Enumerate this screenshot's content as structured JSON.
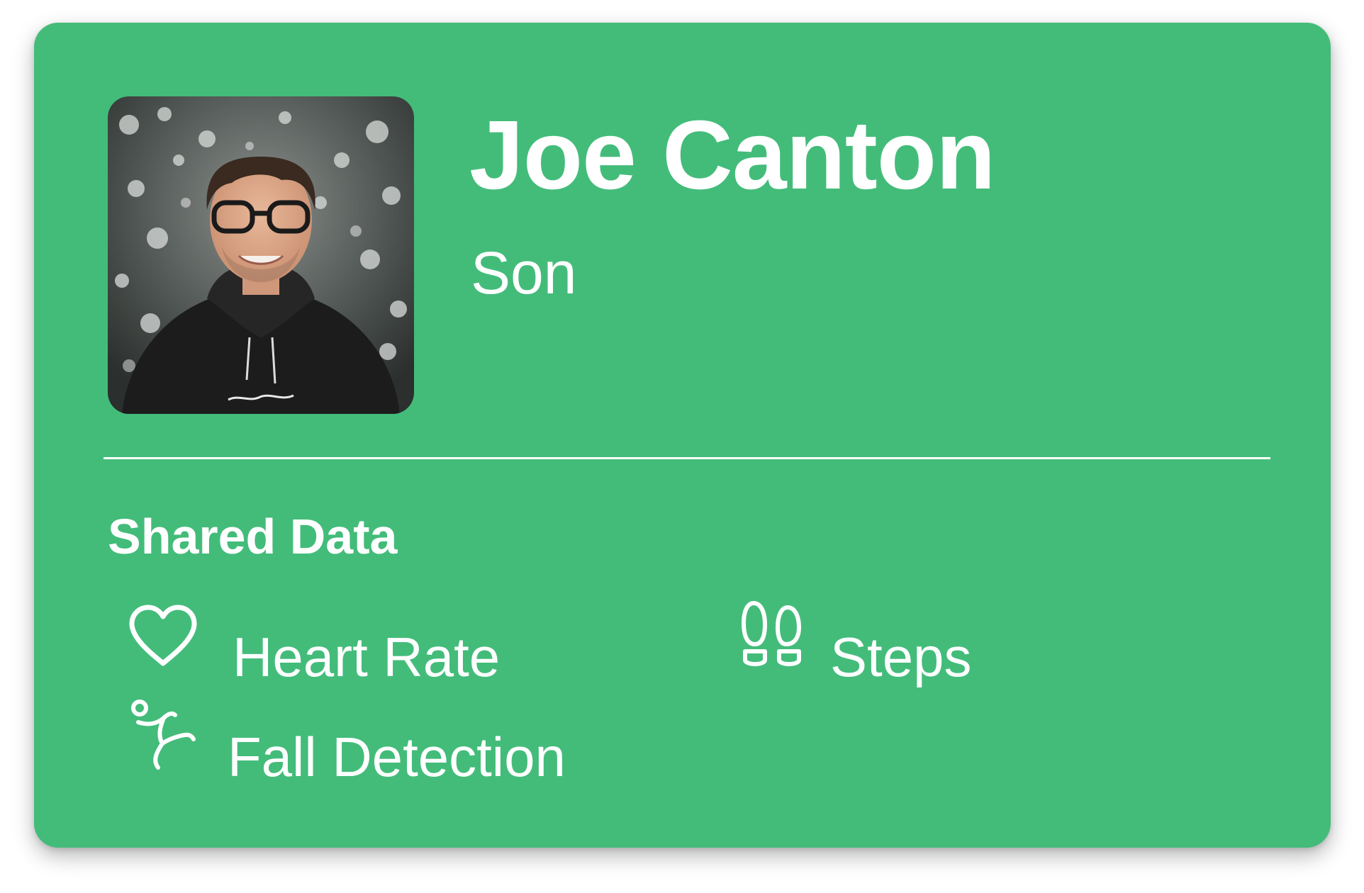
{
  "profile": {
    "name": "Joe Canton",
    "relation": "Son",
    "avatar": "profile-photo",
    "card_color": "#43bc7a"
  },
  "shared_data": {
    "title": "Shared Data",
    "items": [
      {
        "label": "Heart Rate",
        "icon": "heart-icon"
      },
      {
        "label": "Steps",
        "icon": "footprints-icon"
      },
      {
        "label": "Fall Detection",
        "icon": "fall-detection-icon"
      }
    ]
  }
}
